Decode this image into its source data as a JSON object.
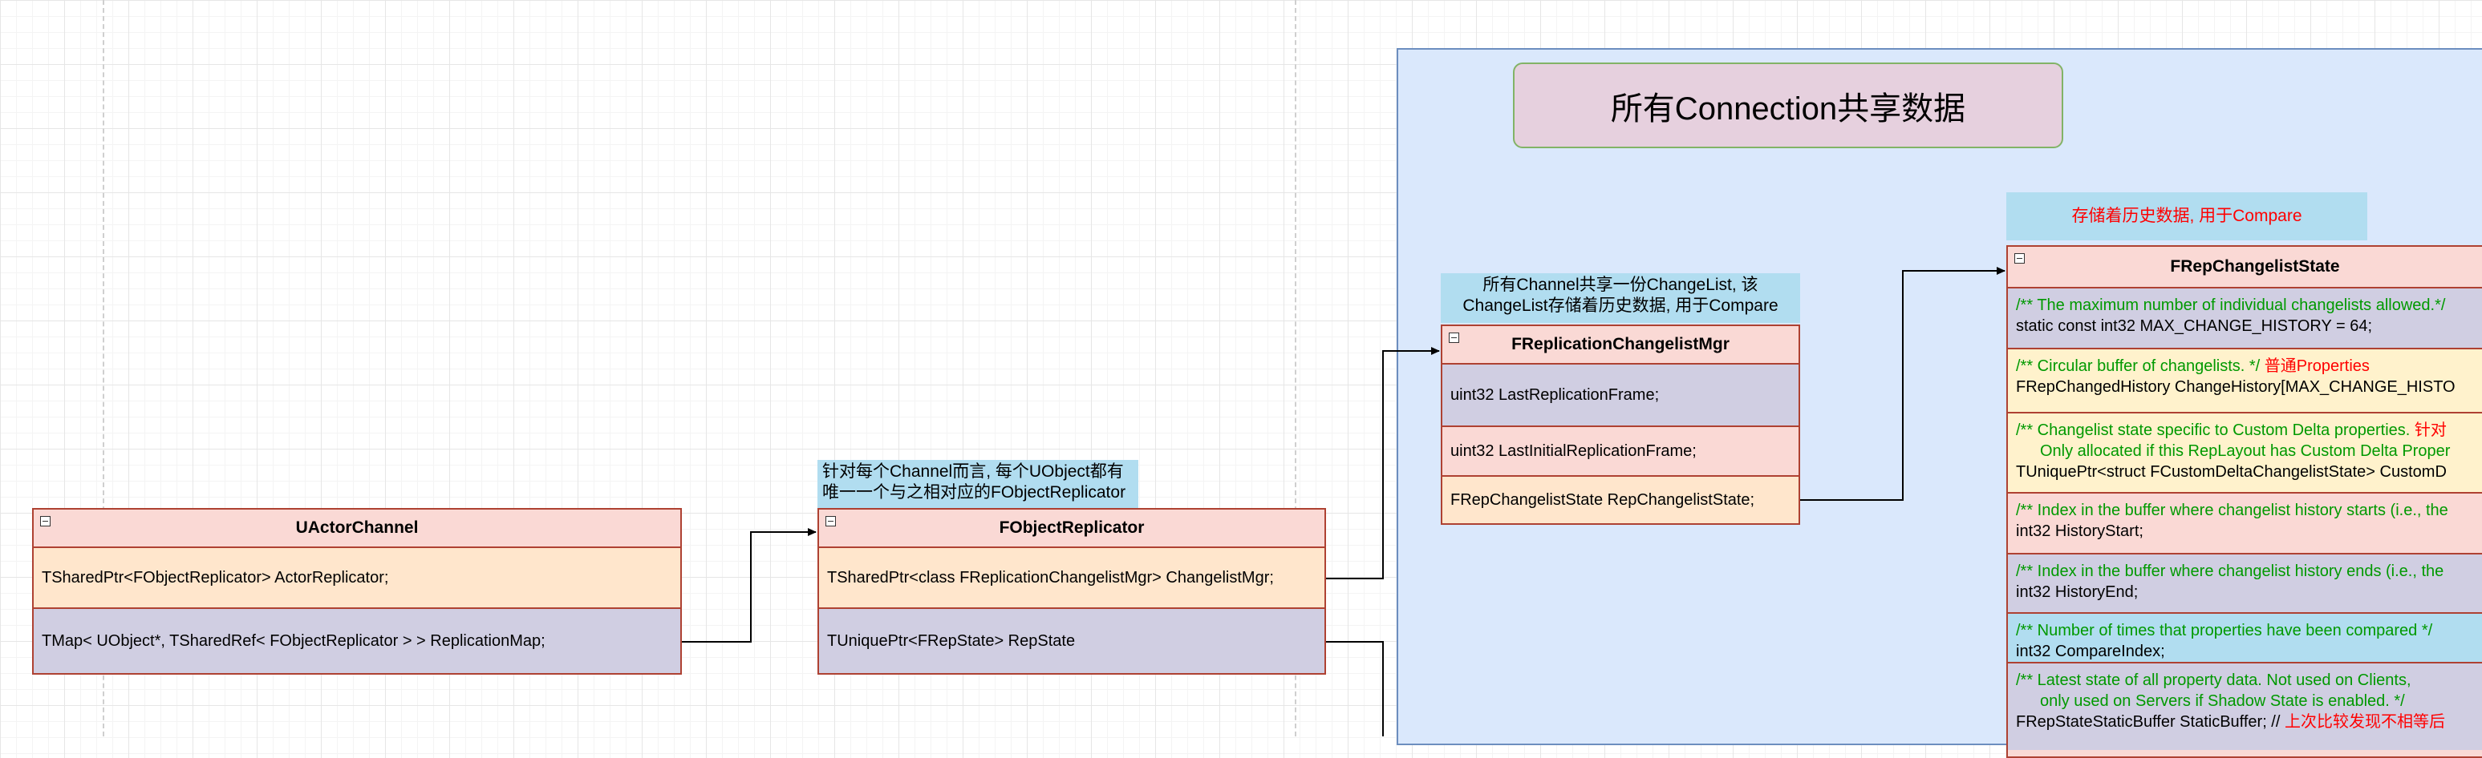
{
  "panel_title": "所有Connection共享数据",
  "notes": {
    "history_note": "存储着历史数据, 用于Compare",
    "changelist_mgr_note_line1": "所有Channel共享一份ChangeList, 该",
    "changelist_mgr_note_line2": "ChangeList存储着历史数据, 用于Compare",
    "replicator_note_line1": "针对每个Channel而言, 每个UObject都有",
    "replicator_note_line2": "唯一一个与之相对应的FObjectReplicator"
  },
  "classes": {
    "actor_channel": {
      "title": "UActorChannel",
      "fields": [
        "TSharedPtr<FObjectReplicator> ActorReplicator;",
        "TMap< UObject*, TSharedRef< FObjectReplicator > > ReplicationMap;"
      ]
    },
    "object_replicator": {
      "title": "FObjectReplicator",
      "fields": [
        "TSharedPtr<class FReplicationChangelistMgr> ChangelistMgr;",
        "TUniquePtr<FRepState>  RepState"
      ]
    },
    "changelist_mgr": {
      "title": "FReplicationChangelistMgr",
      "fields": [
        "uint32 LastReplicationFrame;",
        "uint32 LastInitialReplicationFrame;",
        "FRepChangelistState RepChangelistState;"
      ]
    },
    "changelist_state": {
      "title": "FRepChangelistState",
      "fields": [
        {
          "comment": "/** The maximum number of individual changelists allowed.*/",
          "code": "static const int32 MAX_CHANGE_HISTORY = 64;"
        },
        {
          "comment": "/** Circular buffer of changelists. */",
          "comment_note": "普通Properties",
          "code": "FRepChangedHistory ChangeHistory[MAX_CHANGE_HISTO"
        },
        {
          "comment": "/** Changelist state specific to Custom Delta properties.",
          "comment_note": "针对",
          "comment2": "Only allocated if this RepLayout has Custom Delta Proper",
          "code": "TUniquePtr<struct FCustomDeltaChangelistState> CustomD"
        },
        {
          "comment": "/** Index in the buffer where changelist history starts (i.e., the",
          "code": "int32 HistoryStart;"
        },
        {
          "comment": "/** Index in the buffer where changelist history ends (i.e., the",
          "code": "int32 HistoryEnd;"
        },
        {
          "comment": "/** Number of times that properties have been compared */",
          "code": "int32 CompareIndex;"
        },
        {
          "comment": "/** Latest state of all property data. Not used on Clients,",
          "comment2": "only used on Servers if Shadow State is enabled. */",
          "code": "FRepStateStaticBuffer StaticBuffer; //",
          "code_note": "上次比较发现不相等后"
        }
      ]
    }
  },
  "colors": {
    "panel_fill": "#dae8fc",
    "class_header": "#fad9d5",
    "note_fill": "#b1ddf0",
    "comment_text": "#009900",
    "highlight_text": "#ff0000"
  }
}
